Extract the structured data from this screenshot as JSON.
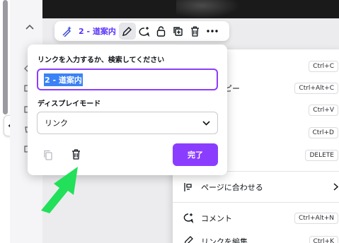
{
  "toolbar": {
    "link_label": "2 - 道案内",
    "icons": [
      "magic-pen-icon",
      "pencil-icon",
      "comment-add-icon",
      "lock-icon",
      "duplicate-icon",
      "trash-icon",
      "more-icon"
    ]
  },
  "popover": {
    "heading": "リンクを入力するか、検索してください",
    "input_value": "2 - 道案内",
    "display_mode_heading": "ディスプレイモード",
    "display_mode_value": "リンク",
    "done_label": "完了"
  },
  "context_menu": {
    "items": [
      {
        "label": "",
        "key": "Ctrl+C"
      },
      {
        "label": "ルをコピー",
        "key": "Ctrl+Alt+C"
      },
      {
        "label": "け",
        "key": "Ctrl+V"
      },
      {
        "label": "",
        "key": "Ctrl+D"
      },
      {
        "label": "",
        "key": "DELETE"
      },
      {
        "label": "ページに合わせる",
        "key": ""
      },
      {
        "label": "コメント",
        "key": "Ctrl+Alt+N"
      },
      {
        "label": "リンクを編集",
        "key": "Ctrl+K"
      }
    ]
  },
  "colors": {
    "accent": "#8b3dff",
    "link": "#5a32fa",
    "selection": "#3b82f6",
    "arrow": "#22e05a"
  }
}
